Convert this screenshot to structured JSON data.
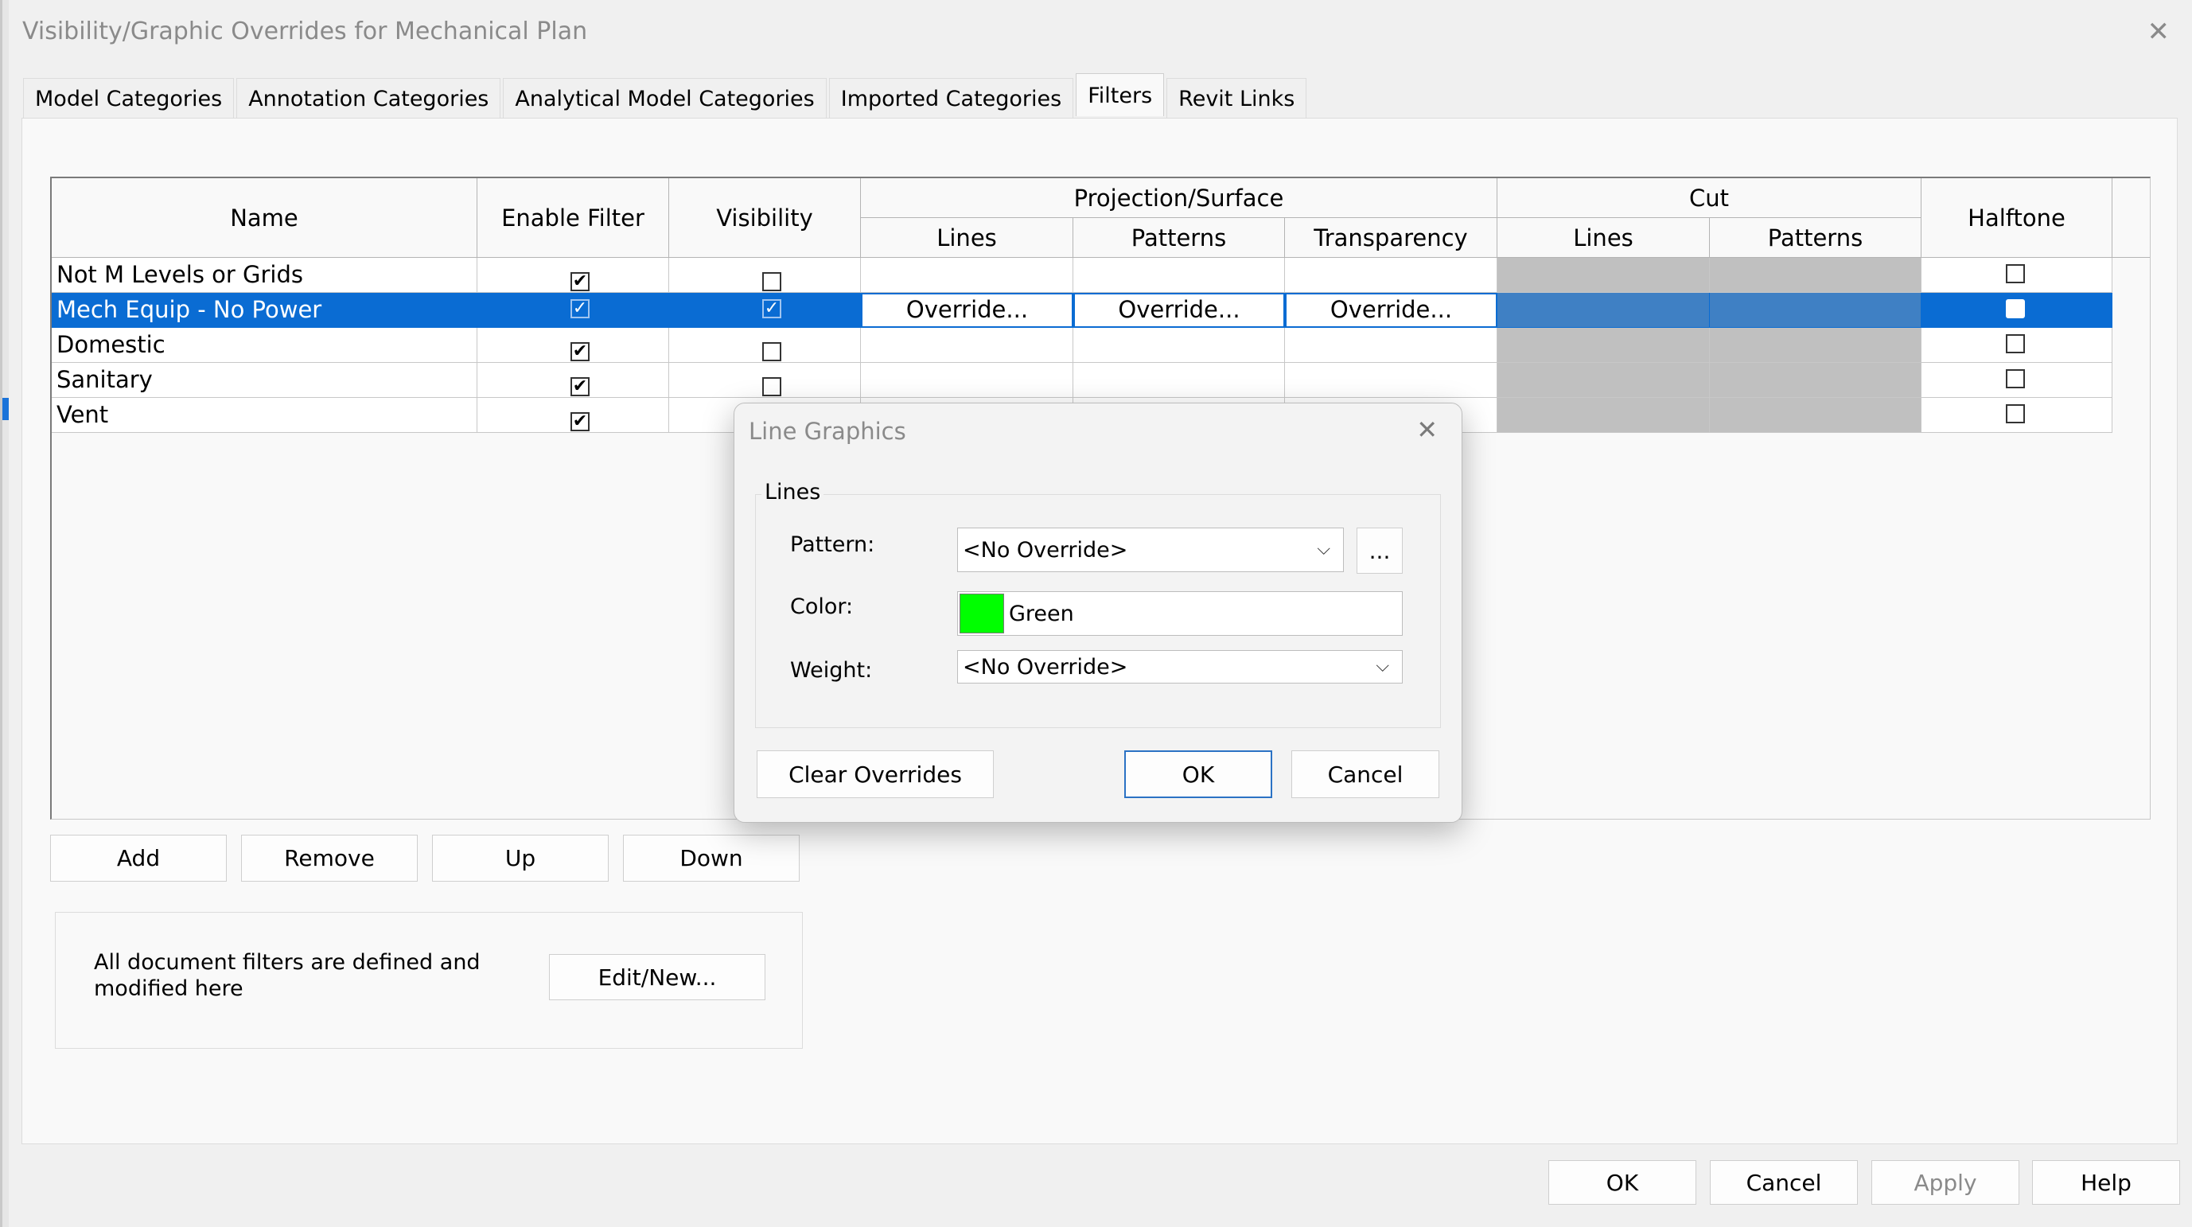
{
  "window": {
    "title": "Visibility/Graphic Overrides for Mechanical Plan"
  },
  "tabs": [
    {
      "label": "Model Categories"
    },
    {
      "label": "Annotation Categories"
    },
    {
      "label": "Analytical Model Categories"
    },
    {
      "label": "Imported Categories"
    },
    {
      "label": "Filters"
    },
    {
      "label": "Revit Links"
    }
  ],
  "active_tab": "Filters",
  "table": {
    "headers": {
      "name": "Name",
      "enable_filter": "Enable Filter",
      "visibility": "Visibility",
      "projection_surface": "Projection/Surface",
      "proj_lines": "Lines",
      "proj_patterns": "Patterns",
      "proj_transparency": "Transparency",
      "cut": "Cut",
      "cut_lines": "Lines",
      "cut_patterns": "Patterns",
      "halftone": "Halftone"
    },
    "rows": [
      {
        "name": "Not M Levels or Grids",
        "enabled": true,
        "visible": false,
        "halftone": false
      },
      {
        "name": "Mech Equip - No Power",
        "enabled": true,
        "visible": true,
        "halftone": false,
        "selected": true
      },
      {
        "name": "Domestic",
        "enabled": true,
        "visible": false,
        "halftone": false
      },
      {
        "name": "Sanitary",
        "enabled": true,
        "visible": false,
        "halftone": false
      },
      {
        "name": "Vent",
        "enabled": true,
        "visible": false,
        "halftone": false
      }
    ],
    "override_label": "Override...",
    "check_glyph": "✔",
    "check_glyph_sel": "✓"
  },
  "row_buttons": {
    "add": "Add",
    "remove": "Remove",
    "up": "Up",
    "down": "Down"
  },
  "info": {
    "text": "All document filters are defined and modified here",
    "edit_new": "Edit/New..."
  },
  "footer": {
    "ok": "OK",
    "cancel": "Cancel",
    "apply": "Apply",
    "help": "Help"
  },
  "dialog": {
    "title": "Line Graphics",
    "group": "Lines",
    "pattern_label": "Pattern:",
    "pattern_value": "<No Override>",
    "browse": "...",
    "color_label": "Color:",
    "color_value": "Green",
    "color_hex": "#00ff00",
    "weight_label": "Weight:",
    "weight_value": "<No Override>",
    "clear": "Clear Overrides",
    "ok": "OK",
    "cancel": "Cancel"
  },
  "icons": {
    "close": "close-icon",
    "chevron": "chevron-down-icon"
  },
  "colors": {
    "selection": "#0a6cd3",
    "disabled_cell": "#c0c0c0"
  }
}
